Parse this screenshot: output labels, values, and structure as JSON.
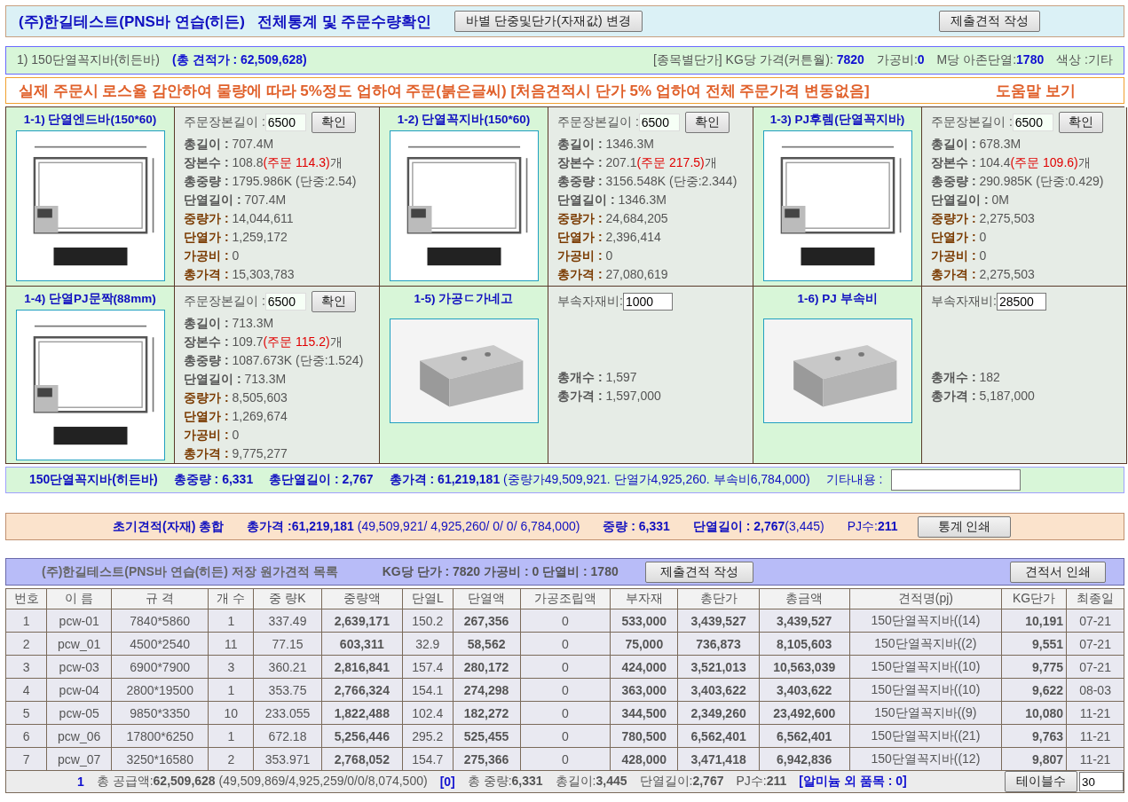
{
  "header": {
    "title": "(주)한길테스트(PNS바 연습(히든)",
    "subtitle": "전체통계 및 주문수량확인",
    "buttons": [
      "바별 단중및단가(자재값) 변경",
      "제출견적 작성"
    ]
  },
  "info": {
    "name": "1) 150단열꼭지바(히든바)",
    "total": "(총 견적가 : 62,509,628)",
    "items": [
      "[종목별단가] KG당 가격(커튼월): **7820**",
      "가공비:**0**",
      "M당 아존단열:**1780**",
      "색상 :기타"
    ]
  },
  "notice": {
    "text": "실제 주문시 로스율 감안하여 물량에 따라 5%정도 업하여 주문(붉은글씨) [처음견적시 단가 5% 업하여 전체 주문가격 변동없음]",
    "link": "도움말 보기"
  },
  "panels": [
    {
      "kind": "profile",
      "title": "1-1) 단열엔드바(150*60)",
      "input": {
        "label": "주문장본길이 :",
        "value": "6500"
      },
      "button": "확인",
      "stats": [
        {
          "label": "총길이 :",
          "value": "707.4M",
          "price": false
        },
        {
          "label": "장본수 :",
          "value": "108.8",
          "note": "(주문 114.3)",
          "suffix": "개",
          "price": false
        },
        {
          "label": "총중량 :",
          "value": "1795.986K  (단중:2.54)",
          "price": false
        },
        {
          "label": "단열길이 :",
          "value": "707.4M",
          "price": false
        },
        {
          "label": "중량가 :",
          "value": "14,044,611",
          "price": true
        },
        {
          "label": "단열가 :",
          "value": "1,259,172",
          "price": true
        },
        {
          "label": "가공비 :",
          "value": "0",
          "price": true
        },
        {
          "label": "총가격 :",
          "value": "15,303,783",
          "price": true
        }
      ]
    },
    {
      "kind": "profile",
      "title": "1-2) 단열꼭지바(150*60)",
      "input": {
        "label": "주문장본길이 :",
        "value": "6500"
      },
      "button": "확인",
      "stats": [
        {
          "label": "총길이 :",
          "value": "1346.3M",
          "price": false
        },
        {
          "label": "장본수 :",
          "value": "207.1",
          "note": "(주문 217.5)",
          "suffix": "개",
          "price": false
        },
        {
          "label": "총중량 :",
          "value": "3156.548K  (단중:2.344)",
          "price": false
        },
        {
          "label": "단열길이 :",
          "value": "1346.3M",
          "price": false
        },
        {
          "label": "중량가 :",
          "value": "24,684,205",
          "price": true
        },
        {
          "label": "단열가 :",
          "value": "2,396,414",
          "price": true
        },
        {
          "label": "가공비 :",
          "value": "0",
          "price": true
        },
        {
          "label": "총가격 :",
          "value": "27,080,619",
          "price": true
        }
      ]
    },
    {
      "kind": "profile",
      "title": "1-3) PJ후렘(단열꼭지바)",
      "input": {
        "label": "주문장본길이 :",
        "value": "6500"
      },
      "button": "확인",
      "stats": [
        {
          "label": "총길이 :",
          "value": "678.3M",
          "price": false
        },
        {
          "label": "장본수 :",
          "value": "104.4",
          "note": "(주문 109.6)",
          "suffix": "개",
          "price": false
        },
        {
          "label": "총중량 :",
          "value": "290.985K  (단중:0.429)",
          "price": false
        },
        {
          "label": "단열길이 :",
          "value": "0M",
          "price": false
        },
        {
          "label": "중량가 :",
          "value": "2,275,503",
          "price": true
        },
        {
          "label": "단열가 :",
          "value": "0",
          "price": true
        },
        {
          "label": "가공비 :",
          "value": "0",
          "price": true
        },
        {
          "label": "총가격 :",
          "value": "2,275,503",
          "price": true
        }
      ]
    },
    {
      "kind": "profile",
      "title": "1-4) 단열PJ문짝(88mm)",
      "input": {
        "label": "주문장본길이 :",
        "value": "6500"
      },
      "button": "확인",
      "stats": [
        {
          "label": "총길이 :",
          "value": "713.3M",
          "price": false
        },
        {
          "label": "장본수 :",
          "value": "109.7",
          "note": "(주문 115.2)",
          "suffix": "개",
          "price": false
        },
        {
          "label": "총중량 :",
          "value": "1087.673K  (단중:1.524)",
          "price": false
        },
        {
          "label": "단열길이 :",
          "value": "713.3M",
          "price": false
        },
        {
          "label": "중량가 :",
          "value": "8,505,603",
          "price": true
        },
        {
          "label": "단열가 :",
          "value": "1,269,674",
          "price": true
        },
        {
          "label": "가공비 :",
          "value": "0",
          "price": true
        },
        {
          "label": "총가격 :",
          "value": "9,775,277",
          "price": true
        }
      ]
    },
    {
      "kind": "accessory",
      "title": "1-5) 가공ㄷ가네고",
      "input": {
        "label": "부속자재비:",
        "value": "1000"
      },
      "stats": [
        {
          "label": "총개수 :",
          "value": "1,597",
          "price": false
        },
        {
          "label": "총가격 :",
          "value": "1,597,000",
          "price": false
        }
      ]
    },
    {
      "kind": "accessory",
      "title": "1-6) PJ 부속비",
      "input": {
        "label": "부속자재비:",
        "value": "28500"
      },
      "stats": [
        {
          "label": "총개수 :",
          "value": "182",
          "price": false
        },
        {
          "label": "총가격 :",
          "value": "5,187,000",
          "price": false
        }
      ]
    }
  ],
  "summary": {
    "items": [
      "**150단열꼭지바(히든바)**",
      "**총중량 : 6,331**",
      "**총단열길이 : 2,767**",
      "**총가격 : 61,219,181** (중량가49,509,921.  단열가4,925,260.  부속비6,784,000)"
    ],
    "memo_label": "기타내용 :"
  },
  "totals": {
    "items": [
      "**초기견적(자재) 총합**",
      "**총가격 :61,219,181** (49,509,921/  4,925,260/  0/  0/  6,784,000)",
      "**중량 : 6,331**",
      "**단열길이 : 2,767**(3,445)",
      "PJ수:**211**"
    ],
    "button": "통계 인쇄"
  },
  "list": {
    "title": "(주)한길테스트(PNS바 연습(히든) 저장 원가견적 목록",
    "rates": "KG당 단가 : 7820  가공비 : 0  단열비 : 1780",
    "buttons": [
      "제출견적 작성",
      "견적서 인쇄"
    ]
  },
  "table": {
    "columns": [
      {
        "label": "번호",
        "bold": false
      },
      {
        "label": "이 름",
        "bold": false
      },
      {
        "label": "규 격",
        "bold": false
      },
      {
        "label": "개 수",
        "bold": false
      },
      {
        "label": "중 량K",
        "bold": false
      },
      {
        "label": "중량액",
        "bold": true
      },
      {
        "label": "단열L",
        "bold": false
      },
      {
        "label": "단열액",
        "bold": true
      },
      {
        "label": "가공조립액",
        "bold": false
      },
      {
        "label": "부자재",
        "bold": true
      },
      {
        "label": "총단가",
        "bold": true
      },
      {
        "label": "총금액",
        "bold": true
      },
      {
        "label": "견적명(pj)",
        "bold": false
      },
      {
        "label": "KG단가",
        "bold": true
      },
      {
        "label": "최종일",
        "bold": false
      }
    ],
    "rows": [
      [
        "1",
        "pcw-01",
        "7840*5860",
        "1",
        "337.49",
        "2,639,171",
        "150.2",
        "267,356",
        "0",
        "533,000",
        "3,439,527",
        "3,439,527",
        "150단열꼭지바((14)",
        "10,191",
        "07-21"
      ],
      [
        "2",
        "pcw_01",
        "4500*2540",
        "11",
        "77.15",
        "603,311",
        "32.9",
        "58,562",
        "0",
        "75,000",
        "736,873",
        "8,105,603",
        "150단열꼭지바((2)",
        "9,551",
        "07-21"
      ],
      [
        "3",
        "pcw-03",
        "6900*7900",
        "3",
        "360.21",
        "2,816,841",
        "157.4",
        "280,172",
        "0",
        "424,000",
        "3,521,013",
        "10,563,039",
        "150단열꼭지바((10)",
        "9,775",
        "07-21"
      ],
      [
        "4",
        "pcw-04",
        "2800*19500",
        "1",
        "353.75",
        "2,766,324",
        "154.1",
        "274,298",
        "0",
        "363,000",
        "3,403,622",
        "3,403,622",
        "150단열꼭지바((10)",
        "9,622",
        "08-03"
      ],
      [
        "5",
        "pcw-05",
        "9850*3350",
        "10",
        "233.055",
        "1,822,488",
        "102.4",
        "182,272",
        "0",
        "344,500",
        "2,349,260",
        "23,492,600",
        "150단열꼭지바((9)",
        "10,080",
        "11-21"
      ],
      [
        "6",
        "pcw_06",
        "17800*6250",
        "1",
        "672.18",
        "5,256,446",
        "295.2",
        "525,455",
        "0",
        "780,500",
        "6,562,401",
        "6,562,401",
        "150단열꼭지바((21)",
        "9,763",
        "11-21"
      ],
      [
        "7",
        "pcw_07",
        "3250*16580",
        "2",
        "353.971",
        "2,768,052",
        "154.7",
        "275,366",
        "0",
        "428,000",
        "3,471,418",
        "6,942,836",
        "150단열꼭지바((12)",
        "9,807",
        "11-21"
      ]
    ],
    "footer": [
      {
        "text": "1",
        "blue": true
      },
      {
        "text": "총 공급액:**62,509,628** (49,509,869/4,925,259/0/0/8,074,500)",
        "blue": false
      },
      {
        "text": "[0]",
        "blue": true
      },
      {
        "text": "총 중량:**6,331**",
        "blue": false
      },
      {
        "text": "총길이:**3,445**",
        "blue": false
      },
      {
        "text": "단열길이:**2,767**",
        "blue": false
      },
      {
        "text": "PJ수:**211**",
        "blue": false
      },
      {
        "text": "[알미늄 외 품목 : 0]",
        "blue": true
      }
    ],
    "table_count": {
      "button": "테이블수",
      "value": "30"
    }
  }
}
